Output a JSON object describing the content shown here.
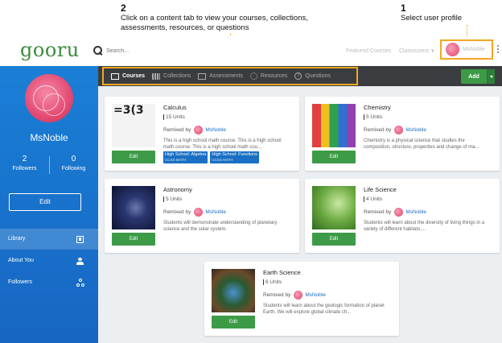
{
  "annotations": {
    "step2_num": "2",
    "step2_text_line1": "Click on a content tab to view your courses, collections,",
    "step2_text_line2": "assessments, resources, or questions",
    "step1_num": "1",
    "step1_text": "Select user profile"
  },
  "header": {
    "logo": "gooru",
    "search_placeholder": "Search...",
    "featured_courses": "Featured Courses",
    "classrooms": "Classrooms",
    "profile_name": "MsNoble"
  },
  "sidebar": {
    "name": "MsNoble",
    "followers_count": "2",
    "followers_label": "Followers",
    "following_count": "0",
    "following_label": "Following",
    "edit_label": "Edit",
    "nav": [
      {
        "label": "Library",
        "icon": "library-icon",
        "active": true
      },
      {
        "label": "About You",
        "icon": "person-icon",
        "active": false
      },
      {
        "label": "Followers",
        "icon": "share-icon",
        "active": false
      }
    ]
  },
  "tabs": [
    {
      "label": "Courses",
      "active": true
    },
    {
      "label": "Collections",
      "active": false
    },
    {
      "label": "Assessments",
      "active": false
    },
    {
      "label": "Resources",
      "active": false
    },
    {
      "label": "Questions",
      "active": false
    }
  ],
  "add_label": "Add",
  "cards": [
    {
      "title": "Calculus",
      "units": "15 Units",
      "remixed_by": "Remixed by",
      "author": "MsNoble",
      "description": "This is a high school math course. This is a high school math course. This is a high school math cou...",
      "edit": "Edit",
      "thumb_text": "=3(3",
      "tags": [
        {
          "label": "High School: Algebra",
          "sub": "CCSS MATH"
        },
        {
          "label": "High School: Functions",
          "sub": "CCSS MATH"
        }
      ]
    },
    {
      "title": "Chemistry",
      "units": "5 Units",
      "remixed_by": "Remixed by",
      "author": "MsNoble",
      "description": "Chemistry is a physical science that studies the composition, structure, properties and change of ma...",
      "edit": "Edit"
    },
    {
      "title": "Astronomy",
      "units": "5 Units",
      "remixed_by": "Remixed by",
      "author": "MsNoble",
      "description": "Students will demonstrate understanding of planetary science and the solar system.",
      "edit": "Edit"
    },
    {
      "title": "Life Science",
      "units": "4 Units",
      "remixed_by": "Remixed by",
      "author": "MsNoble",
      "description": "Students will learn about the diversity of living things in a variety of different habitats....",
      "edit": "Edit"
    },
    {
      "title": "Earth Science",
      "units": "6 Units",
      "remixed_by": "Remixed by",
      "author": "MsNoble",
      "description": "Students will learn about the geologic formation of planet Earth. We will explore global climate ch...",
      "edit": "Edit"
    }
  ],
  "colors": {
    "accent_green": "#3d9b47",
    "sidebar_blue": "#1a7fd6",
    "highlight_orange": "#f5a623",
    "tabbar_dark": "#3a3d40"
  }
}
